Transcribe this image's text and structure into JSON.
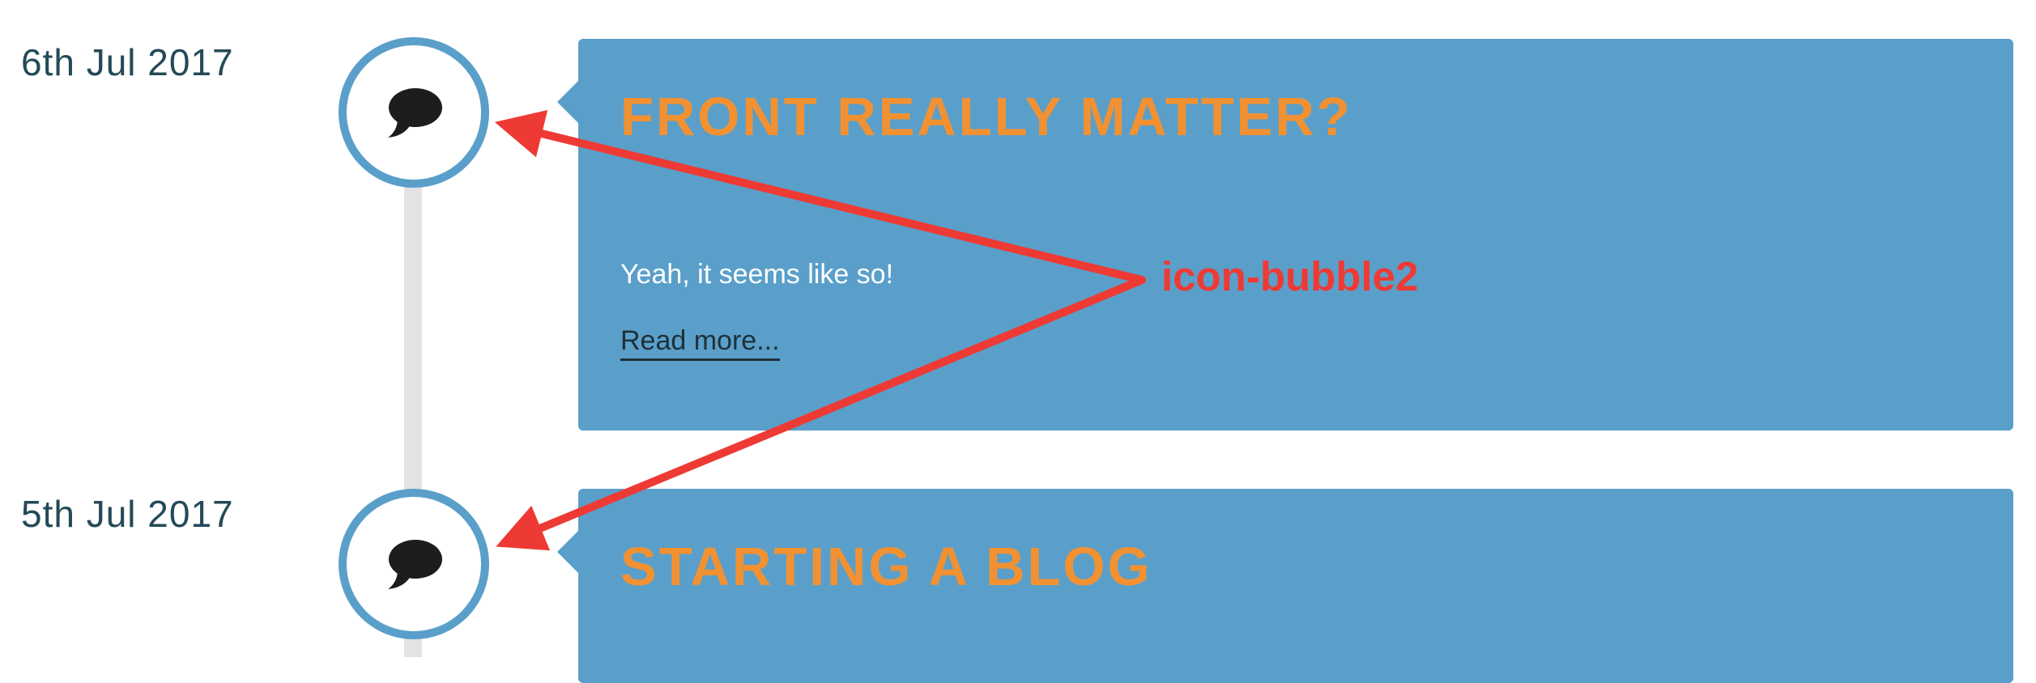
{
  "posts": [
    {
      "date": "6th Jul 2017",
      "icon": "chat-bubble-icon",
      "title": "FRONT REALLY MATTER?",
      "excerpt": "Yeah, it seems like so!",
      "link_label": "Read more..."
    },
    {
      "date": "5th Jul 2017",
      "icon": "chat-bubble-icon",
      "title": "STARTING A BLOG"
    }
  ],
  "annotation": {
    "label": "icon-bubble2",
    "color": "#ee3a34"
  },
  "colors": {
    "card_background": "#5a9fca",
    "title": "#f29132",
    "icon_ring": "#5a9fca",
    "date_text": "#244a57",
    "timeline_line": "#e3e3e3"
  }
}
